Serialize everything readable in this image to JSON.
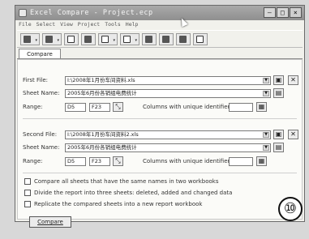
{
  "window": {
    "title": "Excel Compare - Project.ecp"
  },
  "menu": [
    "File",
    "Select",
    "View",
    "Project",
    "Tools",
    "Help"
  ],
  "tab": {
    "label": "Compare"
  },
  "first": {
    "file_label": "First File:",
    "file_value": "I:\\2008年1月份车间资料.xls",
    "sheet_label": "Sheet Name:",
    "sheet_value": "2005年6月份各销组电费统计",
    "range_label": "Range:",
    "range_from": "D5",
    "range_to": "F23",
    "unique_label": "Columns with unique identifier:",
    "unique_value": ""
  },
  "second": {
    "file_label": "Second File:",
    "file_value": "I:\\2008年1月份车间资料2.xls",
    "sheet_label": "Sheet Name:",
    "sheet_value": "2005年6月份各销组电费统计",
    "range_label": "Range:",
    "range_from": "D5",
    "range_to": "F23",
    "unique_label": "Columns with unique identifier:",
    "unique_value": ""
  },
  "options": [
    "Compare all sheets that have the same names in two workbooks",
    "Divide the report into three sheets: deleted, added and changed data",
    "Replicate the compared sheets into a new report workbook"
  ],
  "compare_button": "Compare",
  "step_marker": "⑩"
}
